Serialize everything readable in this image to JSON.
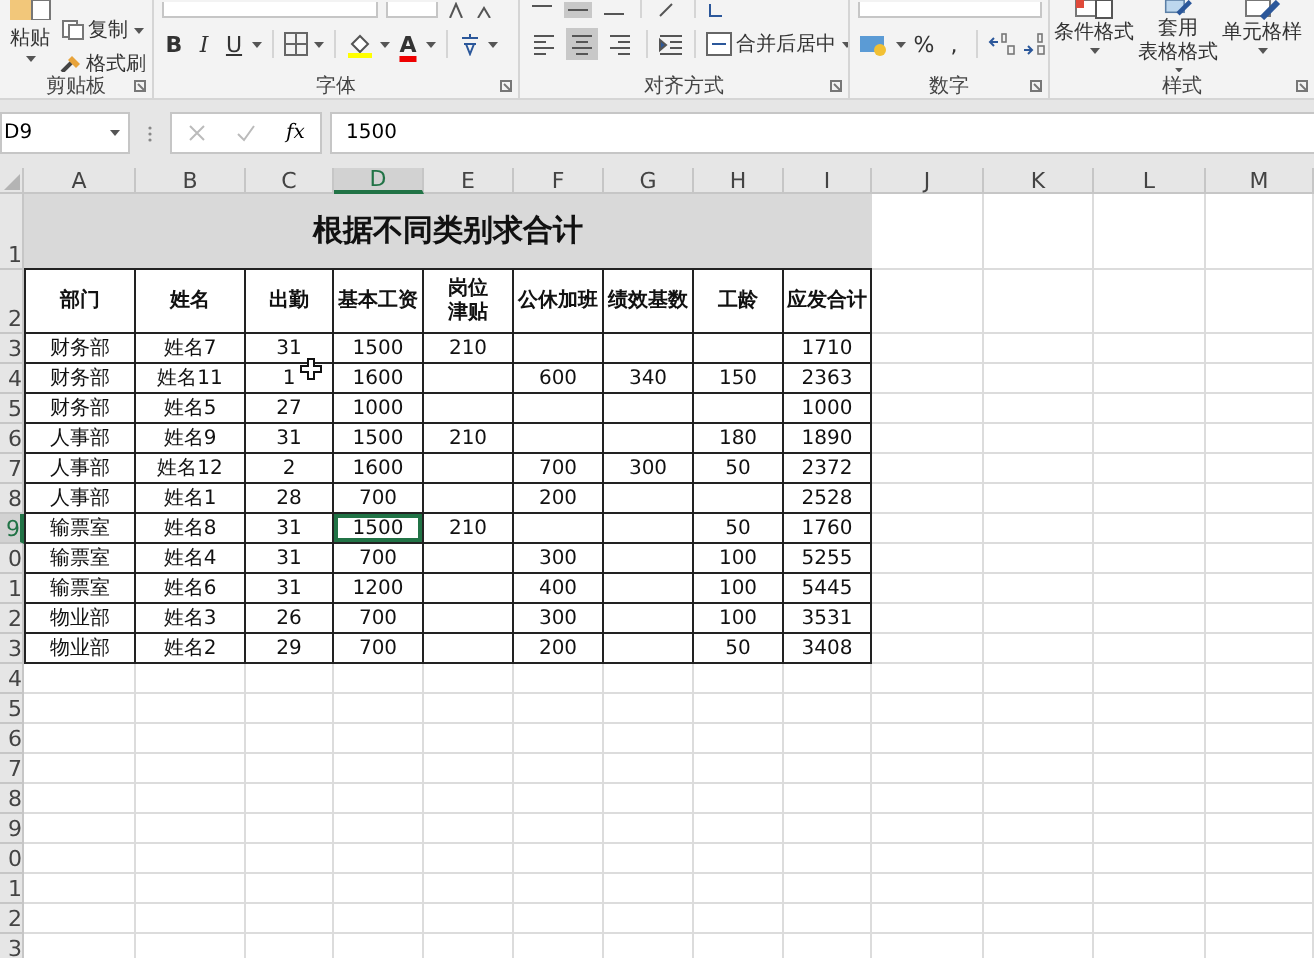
{
  "ribbon": {
    "clipboard": {
      "label": "剪贴板",
      "paste": "粘贴",
      "copy": "复制",
      "format_painter": "格式刷"
    },
    "font": {
      "label": "字体",
      "styles": [
        {
          "kind": "bold",
          "label": "B"
        },
        {
          "kind": "italic",
          "label": "I"
        },
        {
          "kind": "underline",
          "label": "U"
        }
      ],
      "font_color_label": "A"
    },
    "alignment": {
      "label": "对齐方式",
      "aligns": [
        {
          "kind": "left",
          "selected": false
        },
        {
          "kind": "center",
          "selected": true
        },
        {
          "kind": "right",
          "selected": false
        }
      ],
      "merge": "合并后居中"
    },
    "number": {
      "label": "数字",
      "percent": "%",
      "comma": ","
    },
    "styles": {
      "label": "样式",
      "buttons": [
        "条件格式",
        [
          "套用",
          "表格格式"
        ],
        "单元格样"
      ]
    }
  },
  "formula_bar": {
    "name_box": "D9",
    "fx": "fx",
    "formula": "1500"
  },
  "sheet": {
    "columns": [
      {
        "label": "A",
        "selected": false
      },
      {
        "label": "B",
        "selected": false
      },
      {
        "label": "C",
        "selected": false
      },
      {
        "label": "D",
        "selected": true
      },
      {
        "label": "E",
        "selected": false
      },
      {
        "label": "F",
        "selected": false
      },
      {
        "label": "G",
        "selected": false
      },
      {
        "label": "H",
        "selected": false
      },
      {
        "label": "I",
        "selected": false
      },
      {
        "label": "J",
        "selected": false
      },
      {
        "label": "K",
        "selected": false
      },
      {
        "label": "L",
        "selected": false
      },
      {
        "label": "M",
        "selected": false
      }
    ],
    "row_headers": [
      {
        "label": "1",
        "selected": false
      },
      {
        "label": "2",
        "selected": false
      },
      {
        "label": "3",
        "selected": false
      },
      {
        "label": "4",
        "selected": false
      },
      {
        "label": "5",
        "selected": false
      },
      {
        "label": "6",
        "selected": false
      },
      {
        "label": "7",
        "selected": false
      },
      {
        "label": "8",
        "selected": false
      },
      {
        "label": "9",
        "selected": true
      },
      {
        "label": "0",
        "selected": false
      },
      {
        "label": "1",
        "selected": false
      },
      {
        "label": "2",
        "selected": false
      },
      {
        "label": "3",
        "selected": false
      },
      {
        "label": "4",
        "selected": false
      },
      {
        "label": "5",
        "selected": false
      },
      {
        "label": "6",
        "selected": false
      },
      {
        "label": "7",
        "selected": false
      },
      {
        "label": "8",
        "selected": false
      },
      {
        "label": "9",
        "selected": false
      },
      {
        "label": "0",
        "selected": false
      },
      {
        "label": "1",
        "selected": false
      },
      {
        "label": "2",
        "selected": false
      },
      {
        "label": "3",
        "selected": false
      }
    ],
    "table": {
      "title": "根据不同类别求合计",
      "headers": [
        "部门",
        "姓名",
        "出勤",
        "基本工资",
        [
          "岗位",
          "津贴"
        ],
        "公休加班",
        "绩效基数",
        "工龄",
        "应发合计"
      ],
      "rows": [
        [
          "财务部",
          "姓名7",
          "31",
          "1500",
          "210",
          null,
          null,
          null,
          "1710"
        ],
        [
          "财务部",
          "姓名11",
          "1",
          "1600",
          null,
          "600",
          "340",
          "150",
          "2363"
        ],
        [
          "财务部",
          "姓名5",
          "27",
          "1000",
          null,
          null,
          null,
          null,
          "1000"
        ],
        [
          "人事部",
          "姓名9",
          "31",
          "1500",
          "210",
          null,
          null,
          "180",
          "1890"
        ],
        [
          "人事部",
          "姓名12",
          "2",
          "1600",
          null,
          "700",
          "300",
          "50",
          "2372"
        ],
        [
          "人事部",
          "姓名1",
          "28",
          "700",
          null,
          "200",
          null,
          null,
          "2528"
        ],
        [
          "输票室",
          "姓名8",
          "31",
          "1500",
          "210",
          null,
          null,
          "50",
          "1760"
        ],
        [
          "输票室",
          "姓名4",
          "31",
          "700",
          null,
          "300",
          null,
          "100",
          "5255"
        ],
        [
          "输票室",
          "姓名6",
          "31",
          "1200",
          null,
          "400",
          null,
          "100",
          "5445"
        ],
        [
          "物业部",
          "姓名3",
          "26",
          "700",
          null,
          "300",
          null,
          "100",
          "3531"
        ],
        [
          "物业部",
          "姓名2",
          "29",
          "700",
          null,
          "200",
          null,
          "50",
          "3408"
        ]
      ]
    }
  }
}
